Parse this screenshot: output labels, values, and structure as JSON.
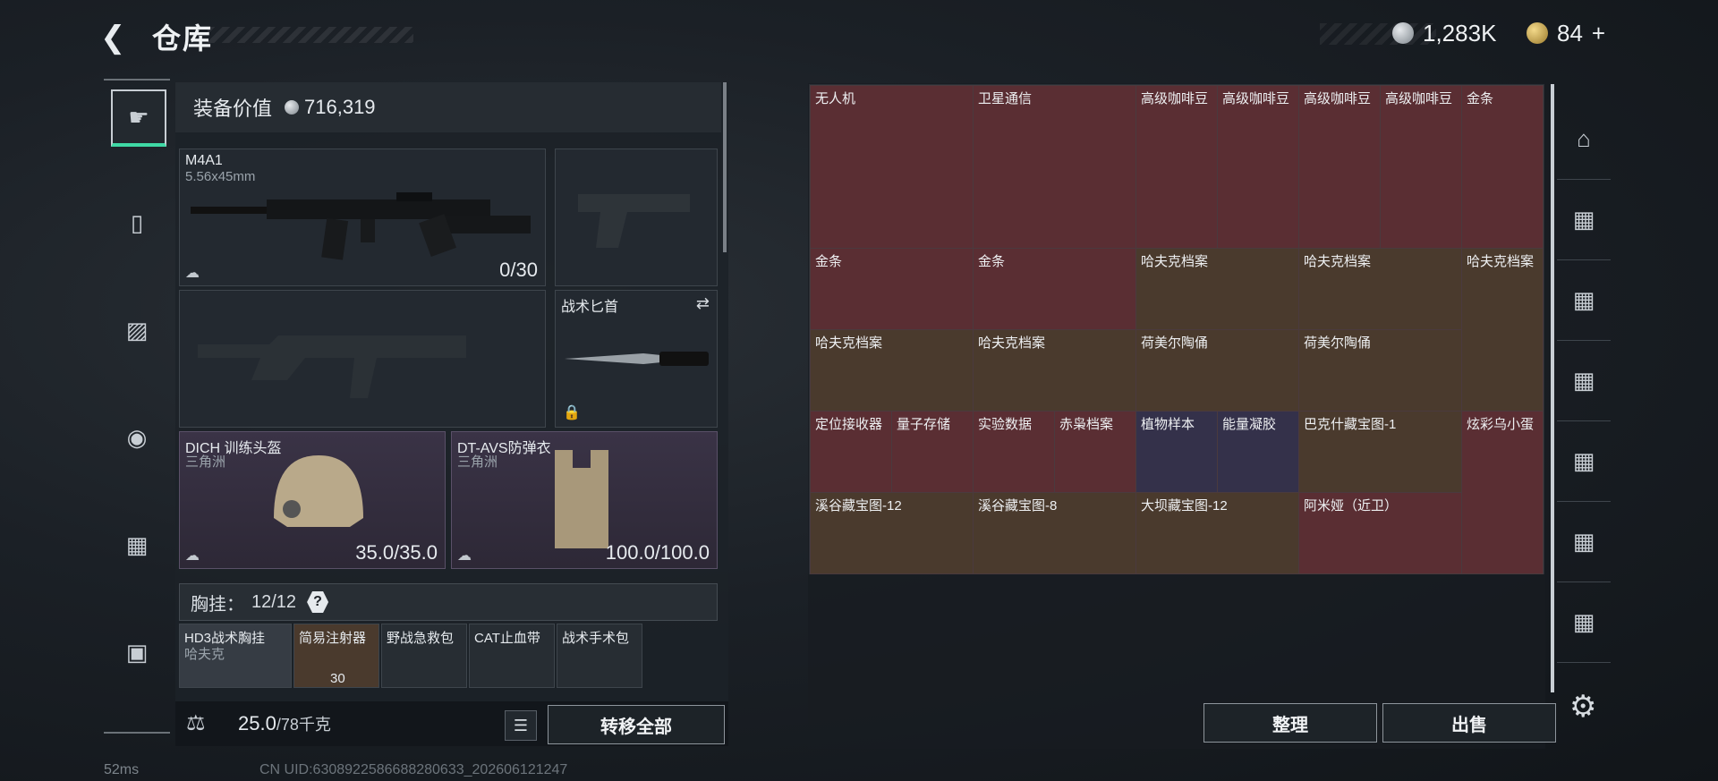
{
  "header": {
    "title": "仓库",
    "currency1": "1,283K",
    "currency2": "84",
    "plus": "+"
  },
  "equip": {
    "value_label": "装备价值",
    "value": "716,319"
  },
  "slots": {
    "primary": {
      "name": "M4A1",
      "caliber": "5.56x45mm",
      "ammo": "0/30"
    },
    "melee": {
      "name": "战术匕首"
    },
    "helmet": {
      "name": "DICH 训练头盔",
      "brand": "三角洲",
      "dur": "35.0/35.0"
    },
    "armor": {
      "name": "DT-AVS防弹衣",
      "brand": "三角洲",
      "dur": "100.0/100.0"
    }
  },
  "chest": {
    "label": "胸挂：",
    "count": "12/12",
    "help": "?",
    "items": [
      {
        "label": "HD3战术胸挂",
        "sub": "哈夫克"
      },
      {
        "label": "简易注射器",
        "sub": "30"
      },
      {
        "label": "野战急救包",
        "sub": ""
      },
      {
        "label": "CAT止血带",
        "sub": ""
      },
      {
        "label": "战术手术包",
        "sub": ""
      }
    ]
  },
  "footer": {
    "weight": "25.0",
    "capacity": "/78千克",
    "transfer": "转移全部",
    "sort": "整理",
    "sell": "出售"
  },
  "stash": [
    {
      "label": "无人机",
      "t": "r"
    },
    {
      "label": "卫星通信",
      "t": "r"
    },
    {
      "label": "高级咖啡豆",
      "t": "r"
    },
    {
      "label": "高级咖啡豆",
      "t": "r"
    },
    {
      "label": "高级咖啡豆",
      "t": "r"
    },
    {
      "label": "高级咖啡豆",
      "t": "r"
    },
    {
      "label": "金条",
      "t": "r"
    },
    {
      "label": "金条",
      "t": "r"
    },
    {
      "label": "金条",
      "t": "r"
    },
    {
      "label": "哈夫克档案",
      "t": "g"
    },
    {
      "label": "哈夫克档案",
      "t": "g"
    },
    {
      "label": "哈夫克档案",
      "t": "g"
    },
    {
      "label": "哈夫克档案",
      "t": "g"
    },
    {
      "label": "哈夫克档案",
      "t": "g"
    },
    {
      "label": "荷美尔陶俑",
      "t": "g"
    },
    {
      "label": "荷美尔陶俑",
      "t": "g"
    },
    {
      "label": "定位接收器",
      "t": "r"
    },
    {
      "label": "量子存储",
      "t": "r"
    },
    {
      "label": "实验数据",
      "t": "r"
    },
    {
      "label": "赤枭档案",
      "t": "r"
    },
    {
      "label": "植物样本",
      "t": "p"
    },
    {
      "label": "能量凝胶",
      "t": "p"
    },
    {
      "label": "巴克什藏宝图-1",
      "t": "g"
    },
    {
      "label": "炫彩乌小蛋",
      "t": "r"
    },
    {
      "label": "溪谷藏宝图-12",
      "t": "g"
    },
    {
      "label": "溪谷藏宝图-8",
      "t": "g"
    },
    {
      "label": "大坝藏宝图-12",
      "t": "g"
    },
    {
      "label": "阿米娅（近卫）",
      "t": "r"
    }
  ],
  "status": {
    "ping": "52ms",
    "uid": "CN UID:6308922586688280633_202606121247"
  }
}
